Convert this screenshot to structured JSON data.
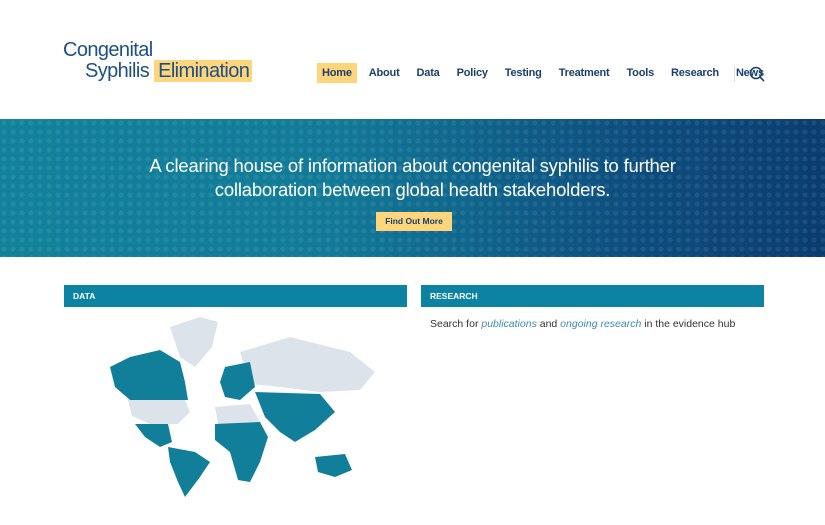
{
  "logo": {
    "line1": "Congenital",
    "line2a": "Syphilis",
    "line2b": "Elimination"
  },
  "nav": {
    "items": [
      "Home",
      "About",
      "Data",
      "Policy",
      "Testing",
      "Treatment",
      "Tools",
      "Research",
      "News"
    ],
    "active": "Home"
  },
  "hero": {
    "line1": "A clearing house of information about congenital syphilis to further",
    "line2": "collaboration between global health stakeholders.",
    "button": "Find Out More"
  },
  "data_section": {
    "title": "DATA"
  },
  "research_section": {
    "title": "RESEARCH",
    "text_before": "Search for ",
    "link1": "publications",
    "text_mid": " and ",
    "link2": "ongoing research",
    "text_after": " in the evidence hub"
  },
  "colors": {
    "navy": "#1b3f6e",
    "gold": "#fdd57a",
    "teal": "#0d83a4",
    "map_highlight": "#127f9a",
    "map_base": "#dde3ea"
  }
}
